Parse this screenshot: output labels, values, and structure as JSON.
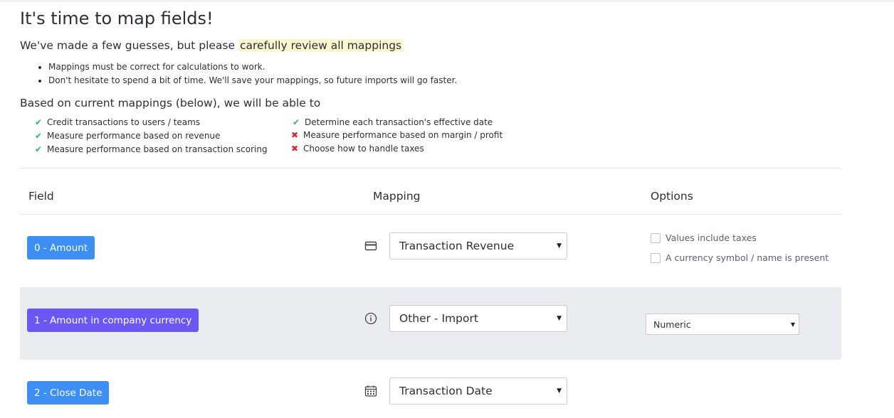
{
  "title": "It's time to map fields!",
  "intro": {
    "prefix": "We've made a few guesses, but please ",
    "highlight": "carefully review all mappings"
  },
  "tips": [
    "Mappings must be correct for calculations to work.",
    "Don't hesitate to spend a bit of time. We'll save your mappings, so future imports will go faster."
  ],
  "capabilities_heading": "Based on current mappings (below), we will be able to",
  "capabilities": [
    {
      "label": "Credit transactions to users / teams",
      "status": "ok"
    },
    {
      "label": "Measure performance based on revenue",
      "status": "ok"
    },
    {
      "label": "Measure performance based on transaction scoring",
      "status": "ok"
    },
    {
      "label": "Determine each transaction's effective date",
      "status": "ok"
    },
    {
      "label": "Measure performance based on margin / profit",
      "status": "no"
    },
    {
      "label": "Choose how to handle taxes",
      "status": "no"
    }
  ],
  "columns": {
    "field": "Field",
    "mapping": "Mapping",
    "options": "Options"
  },
  "rows": [
    {
      "field": "0 - Amount",
      "icon": "credit-card-icon",
      "mapping": "Transaction Revenue",
      "options": [
        "Values include taxes",
        "A currency symbol / name is present"
      ]
    },
    {
      "field": "1 - Amount in company currency",
      "icon": "info-circle-icon",
      "mapping": "Other - Import",
      "type_select": "Numeric"
    },
    {
      "field": "2 - Close Date",
      "icon": "calendar-icon",
      "mapping": "Transaction Date"
    }
  ],
  "colors": {
    "check": "#2bb673",
    "cross": "#e5222f",
    "tag_blue": "#3d8ff5",
    "tag_purple": "#6b57f4",
    "highlight": "#fbf7cf",
    "row_shade": "#e9ecf1"
  }
}
